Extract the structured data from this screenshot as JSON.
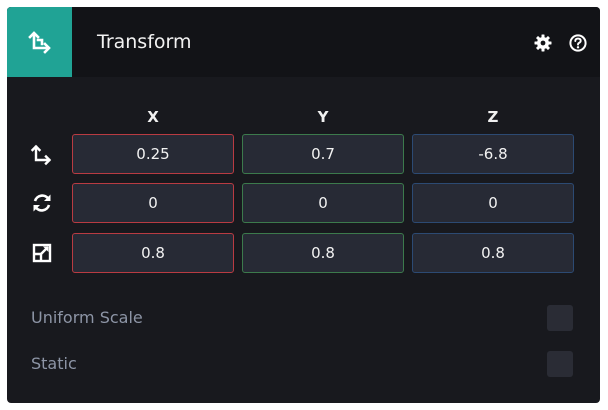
{
  "header": {
    "title": "Transform",
    "icon": "transform-axes-icon",
    "accent_color": "#20a395"
  },
  "columns": [
    "X",
    "Y",
    "Z"
  ],
  "rows": [
    {
      "icon": "position-axes-icon",
      "values": [
        "0.25",
        "0.7",
        "-6.8"
      ]
    },
    {
      "icon": "rotation-icon",
      "values": [
        "0",
        "0",
        "0"
      ]
    },
    {
      "icon": "scale-icon",
      "values": [
        "0.8",
        "0.8",
        "0.8"
      ]
    }
  ],
  "options": {
    "uniform_scale": {
      "label": "Uniform Scale",
      "checked": false
    },
    "static": {
      "label": "Static",
      "checked": false
    }
  },
  "axis_colors": {
    "x": "#b93b42",
    "y": "#3c7a4c",
    "z": "#2c4a73"
  }
}
